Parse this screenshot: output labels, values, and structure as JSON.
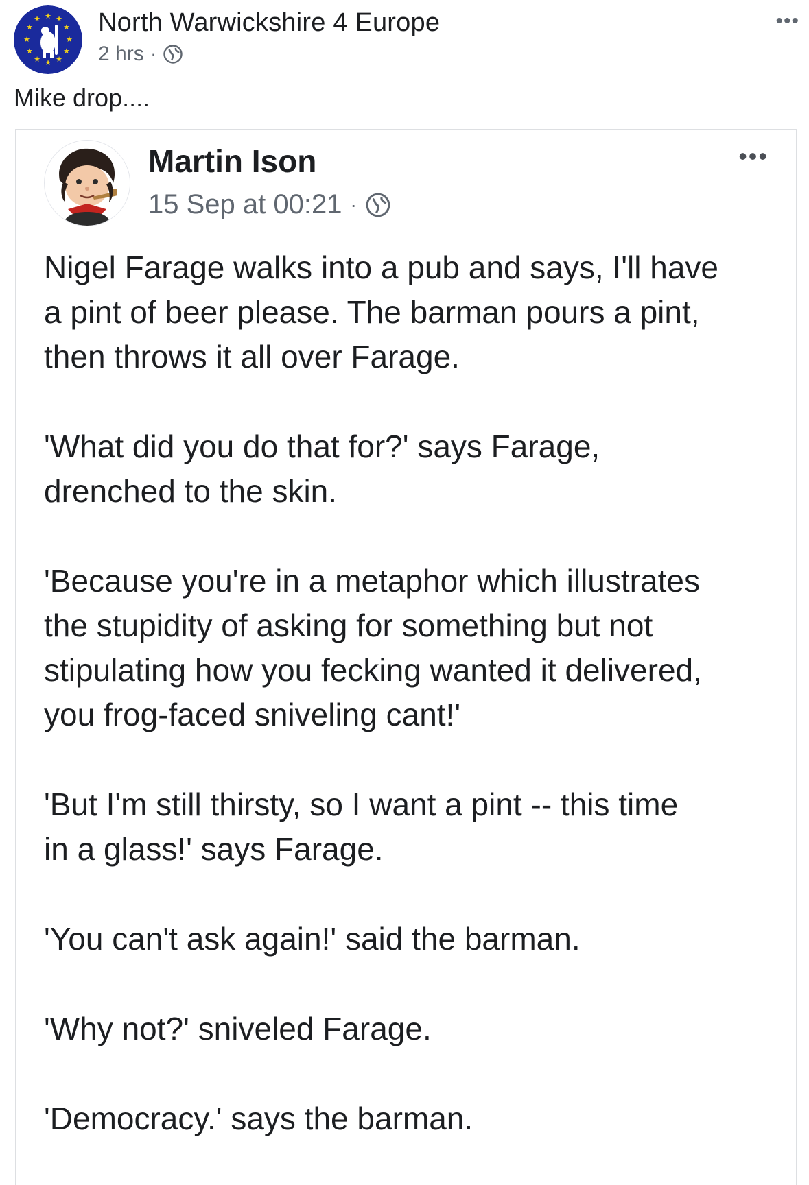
{
  "outer_post": {
    "page_name": "North Warwickshire 4 Europe",
    "timestamp": "2 hrs",
    "separator": "·",
    "privacy_icon": "globe-icon",
    "more_icon": "more-options-icon",
    "more_label": "•••",
    "text": "Mike drop...."
  },
  "shared_post": {
    "author": "Martin Ison",
    "timestamp": "15 Sep at 00:21",
    "separator": "·",
    "privacy_icon": "globe-icon",
    "more_label": "•••",
    "paragraphs": [
      "Nigel Farage walks into a pub and says, I'll have\na pint of beer please. The barman pours a pint,\nthen throws it all over Farage.",
      "'What did you do that for?' says Farage,\ndrenched to the skin.",
      "'Because you're in a metaphor which illustrates\nthe stupidity of asking for something but not\nstipulating how you fecking wanted it delivered,\nyou frog-faced sniveling cant!'",
      "'But I'm still thirsty, so I want a pint -- this time\nin a glass!' says Farage.",
      "'You can't ask again!' said the barman.",
      "'Why not?' sniveled Farage.",
      "'Democracy.' says the barman."
    ]
  },
  "colors": {
    "eu_blue": "#1a2a9c",
    "eu_star": "#f4d21a",
    "meta_gray": "#606770",
    "border": "#dddfe2"
  }
}
